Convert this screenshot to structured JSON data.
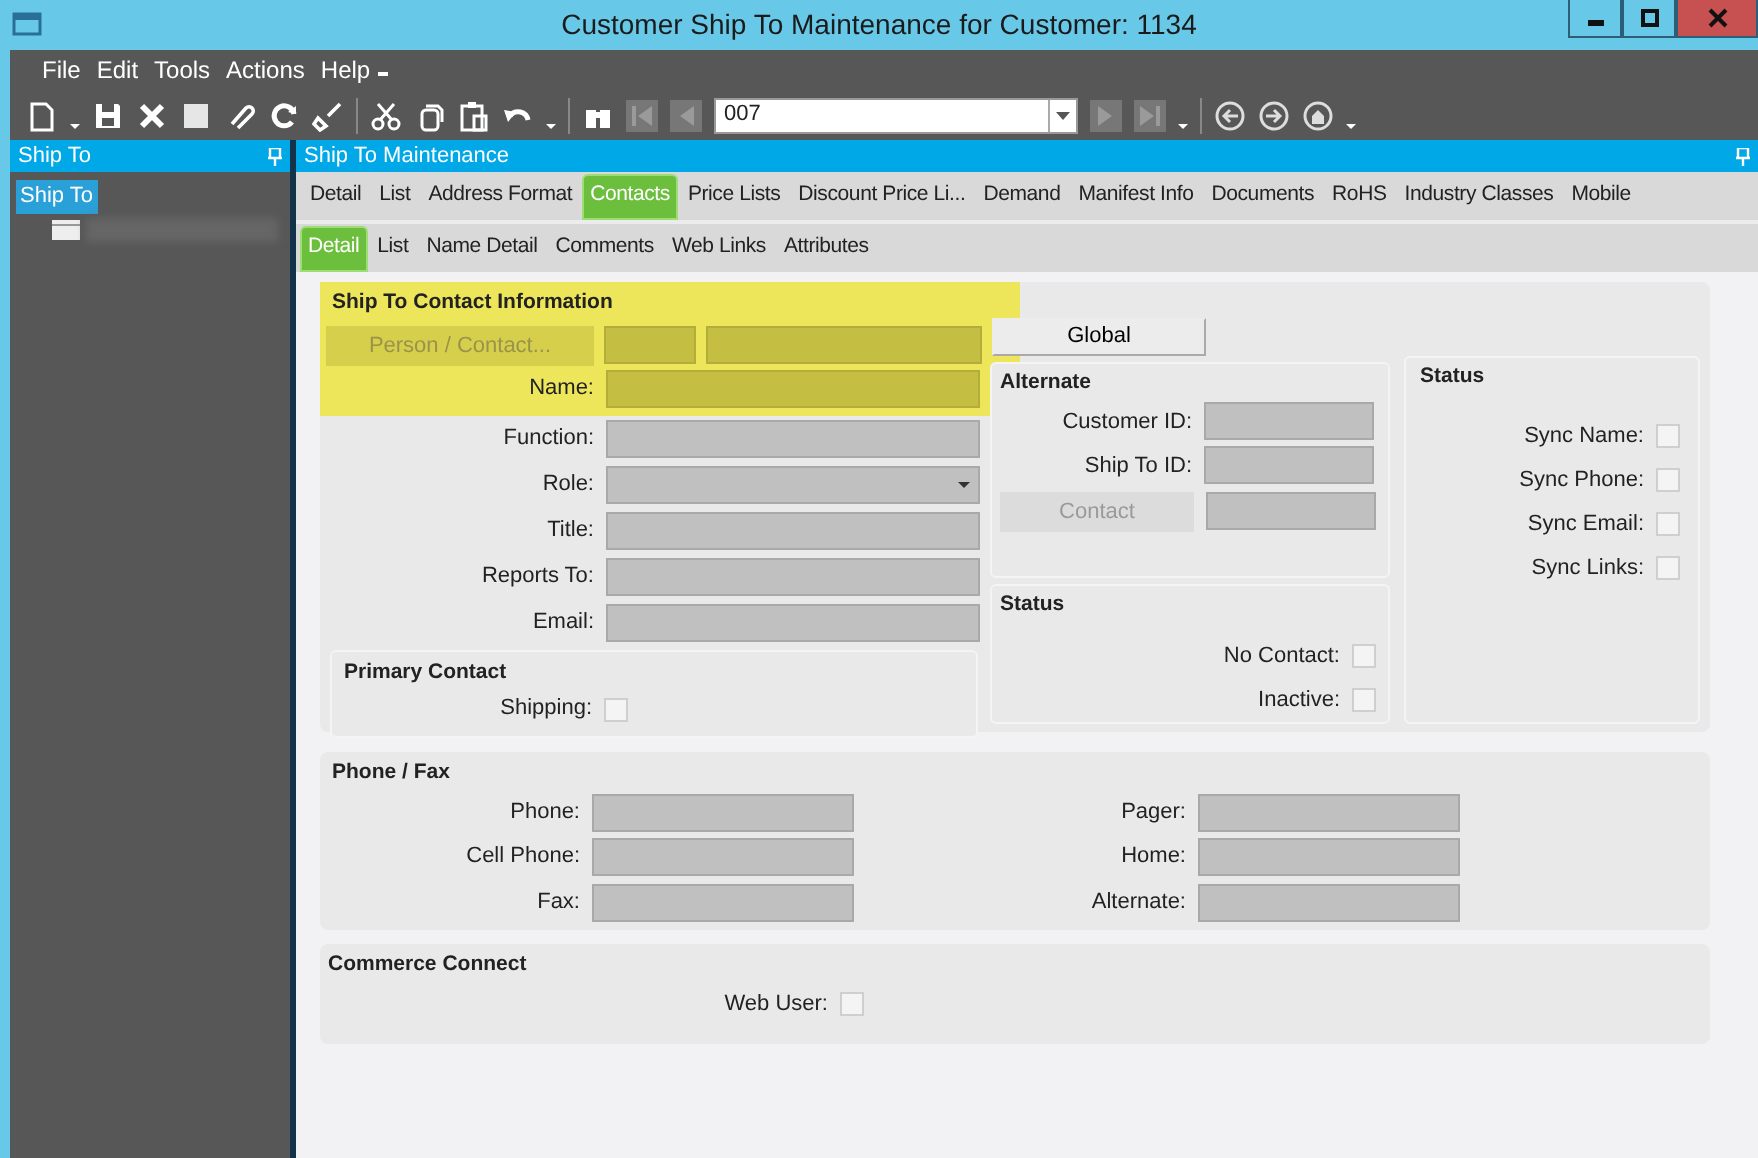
{
  "window": {
    "title": "Customer Ship To Maintenance for Customer: 1134"
  },
  "menu": [
    "File",
    "Edit",
    "Tools",
    "Actions",
    "Help"
  ],
  "toolbar": {
    "record_value": "007"
  },
  "left_panel": {
    "title": "Ship To",
    "tree": [
      {
        "label": "Ship To",
        "selected": true
      }
    ]
  },
  "main_panel": {
    "title": "Ship To Maintenance"
  },
  "tabs": [
    {
      "label": "Detail",
      "selected": false
    },
    {
      "label": "List",
      "selected": false
    },
    {
      "label": "Address Format",
      "selected": false
    },
    {
      "label": "Contacts",
      "selected": true
    },
    {
      "label": "Price Lists",
      "selected": false
    },
    {
      "label": "Discount Price Li...",
      "selected": false
    },
    {
      "label": "Demand",
      "selected": false
    },
    {
      "label": "Manifest Info",
      "selected": false
    },
    {
      "label": "Documents",
      "selected": false
    },
    {
      "label": "RoHS",
      "selected": false
    },
    {
      "label": "Industry Classes",
      "selected": false
    },
    {
      "label": "Mobile",
      "selected": false
    }
  ],
  "subtabs": [
    {
      "label": "Detail",
      "selected": true
    },
    {
      "label": "List",
      "selected": false
    },
    {
      "label": "Name Detail",
      "selected": false
    },
    {
      "label": "Comments",
      "selected": false
    },
    {
      "label": "Web Links",
      "selected": false
    },
    {
      "label": "Attributes",
      "selected": false
    }
  ],
  "contact_info": {
    "title": "Ship To Contact Information",
    "person_button": {
      "label": "Person / Contact...",
      "disabled": true
    },
    "name_label": "Name:",
    "fields": [
      {
        "label": "Function:",
        "kind": "text"
      },
      {
        "label": "Role:",
        "kind": "dropdown"
      },
      {
        "label": "Title:",
        "kind": "text"
      },
      {
        "label": "Reports To:",
        "kind": "text"
      },
      {
        "label": "Email:",
        "kind": "text"
      }
    ]
  },
  "primary_contact": {
    "title": "Primary Contact",
    "checks": [
      {
        "label": "Shipping:",
        "checked": false
      }
    ]
  },
  "global_button": "Global",
  "alternate": {
    "title": "Alternate",
    "fields": [
      {
        "label": "Customer ID:"
      },
      {
        "label": "Ship To ID:"
      }
    ],
    "contact_button": {
      "label": "Contact",
      "disabled": true
    }
  },
  "status_left": {
    "title": "Status",
    "checks": [
      {
        "label": "No Contact:",
        "checked": false
      },
      {
        "label": "Inactive:",
        "checked": false
      }
    ]
  },
  "status_right": {
    "title": "Status",
    "checks": [
      {
        "label": "Sync Name:",
        "checked": false
      },
      {
        "label": "Sync Phone:",
        "checked": false
      },
      {
        "label": "Sync Email:",
        "checked": false
      },
      {
        "label": "Sync Links:",
        "checked": false
      }
    ]
  },
  "phone_fax": {
    "title": "Phone / Fax",
    "left": [
      {
        "label": "Phone:"
      },
      {
        "label": "Cell Phone:"
      },
      {
        "label": "Fax:"
      }
    ],
    "right": [
      {
        "label": "Pager:"
      },
      {
        "label": "Home:"
      },
      {
        "label": "Alternate:"
      }
    ]
  },
  "commerce_connect": {
    "title": "Commerce Connect",
    "checks": [
      {
        "label": "Web User:",
        "checked": false
      }
    ]
  }
}
